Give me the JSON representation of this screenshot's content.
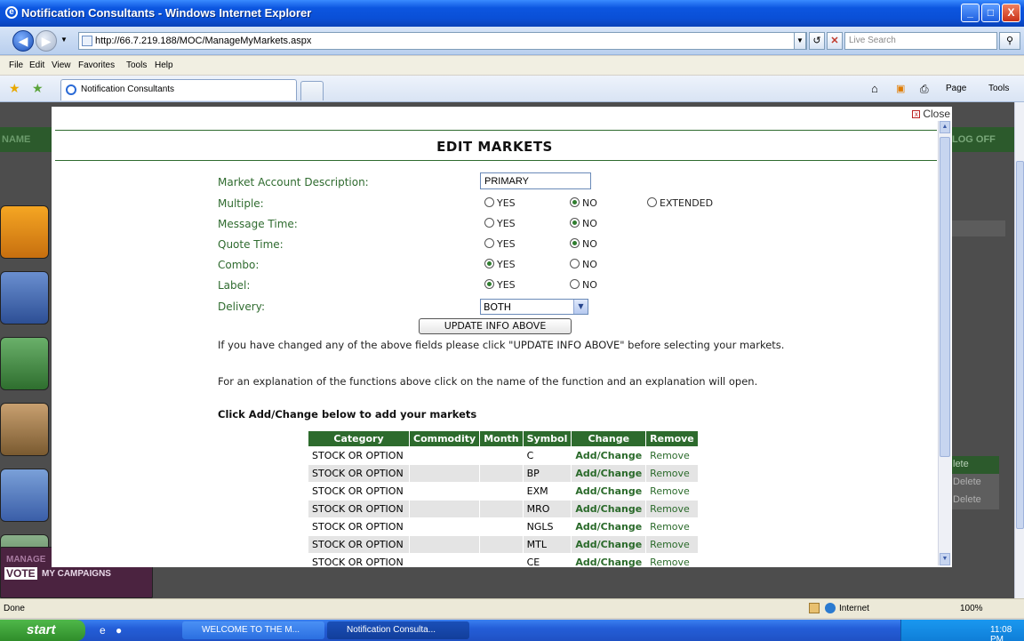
{
  "window": {
    "title": "Notification Consultants - Windows Internet Explorer",
    "btn_min": "_",
    "btn_max": "□",
    "btn_close": "X"
  },
  "address": {
    "url": "http://66.7.219.188/MOC/ManageMyMarkets.aspx",
    "search_placeholder": "Live Search"
  },
  "menu": [
    "File",
    "Edit",
    "View",
    "Favorites",
    "Tools",
    "Help"
  ],
  "tab": {
    "label": "Notification Consultants"
  },
  "command_bar": {
    "page": "Page",
    "tools": "Tools"
  },
  "background": {
    "name_label": "NAME",
    "logoff_label": "LOG OFF",
    "delete_labels": [
      "lete",
      "Delete",
      "Delete"
    ],
    "vote_label": "VOTE",
    "manage_label": "MY CAMPAIGNS",
    "sidebar_partial": "MANAGE"
  },
  "modal": {
    "close_label": "Close",
    "heading": "EDIT MARKETS",
    "form": {
      "desc_label": "Market Account Description:",
      "desc_value": "PRIMARY",
      "multiple_label": "Multiple:",
      "message_time_label": "Message Time:",
      "quote_time_label": "Quote Time:",
      "combo_label": "Combo:",
      "label_label": "Label:",
      "delivery_label": "Delivery:",
      "delivery_value": "BOTH",
      "yes": "YES",
      "no": "NO",
      "extended": "EXTENDED",
      "selected": {
        "multiple": "NO",
        "message_time": "NO",
        "quote_time": "NO",
        "combo": "YES",
        "label": "YES"
      }
    },
    "update_button": "UPDATE INFO ABOVE",
    "info_text_1": "If you have changed any of the above fields please click \"UPDATE INFO ABOVE\" before selecting your markets.",
    "info_text_2": "For an explanation of the functions above click on the name of the function and an explanation will open.",
    "table_heading": "Click Add/Change below to add your markets",
    "table": {
      "headers": [
        "Category",
        "Commodity",
        "Month",
        "Symbol",
        "Change",
        "Remove"
      ],
      "rows": [
        {
          "category": "STOCK OR OPTION",
          "commodity": "",
          "month": "",
          "symbol": "C",
          "change": "Add/Change",
          "remove": "Remove"
        },
        {
          "category": "STOCK OR OPTION",
          "commodity": "",
          "month": "",
          "symbol": "BP",
          "change": "Add/Change",
          "remove": "Remove"
        },
        {
          "category": "STOCK OR OPTION",
          "commodity": "",
          "month": "",
          "symbol": "EXM",
          "change": "Add/Change",
          "remove": "Remove"
        },
        {
          "category": "STOCK OR OPTION",
          "commodity": "",
          "month": "",
          "symbol": "MRO",
          "change": "Add/Change",
          "remove": "Remove"
        },
        {
          "category": "STOCK OR OPTION",
          "commodity": "",
          "month": "",
          "symbol": "NGLS",
          "change": "Add/Change",
          "remove": "Remove"
        },
        {
          "category": "STOCK OR OPTION",
          "commodity": "",
          "month": "",
          "symbol": "MTL",
          "change": "Add/Change",
          "remove": "Remove"
        },
        {
          "category": "STOCK OR OPTION",
          "commodity": "",
          "month": "",
          "symbol": "CE",
          "change": "Add/Change",
          "remove": "Remove"
        }
      ]
    }
  },
  "status": {
    "left": "Done",
    "zone": "Internet",
    "zoom": "100%"
  },
  "taskbar": {
    "start": "start",
    "task1": "WELCOME TO THE M...",
    "task2": "Notification Consulta...",
    "time": "11:08 PM"
  },
  "colors": {
    "accent_green": "#2d6b2d",
    "xp_blue": "#0a4fd6"
  }
}
